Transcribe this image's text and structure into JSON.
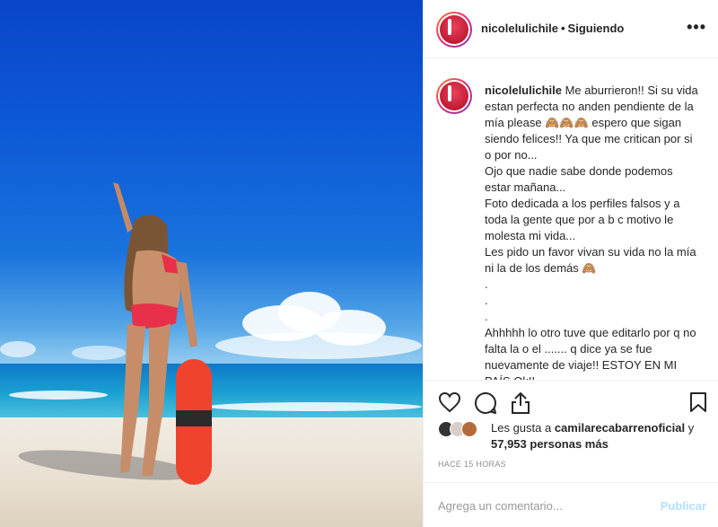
{
  "post": {
    "username": "nicolelulichile",
    "separator": "•",
    "follow_status": "Siguiendo",
    "more_label": "•••",
    "caption": "Me aburrieron!! Si su vida estan perfecta no anden pendiente de la mía please 🙈🙈🙈 espero que sigan siendo felices!! Ya que me critican por si o por no...\nOjo que nadie sabe donde podemos estar mañana...\nFoto dedicada a los perfiles falsos y a toda la gente que por a b c motivo le molesta mi vida...\nLes pido un favor vivan su vida no la mía ni la de los demás 🙈\n.\n.\n.\nAhhhhh lo otro tuve que editarlo por q no falta la o el ....... q dice ya se fue nuevamente de viaje!! ESTOY EN MI PAÍS Ok!!",
    "likes": {
      "prefix": "Les gusta a ",
      "first_liker": "camilarecabarrenoficial",
      "middle": " y ",
      "others": "57,953 personas más"
    },
    "timestamp": "HACE 15 HORAS",
    "comment_placeholder": "Agrega un comentario...",
    "post_button": "Publicar"
  },
  "icons": [
    "heart-icon",
    "comment-icon",
    "share-icon",
    "bookmark-icon",
    "more-icon"
  ],
  "colors": {
    "post_button_disabled": "#b2dffc",
    "muted_text": "#8e8e8e",
    "border": "#efefef"
  }
}
